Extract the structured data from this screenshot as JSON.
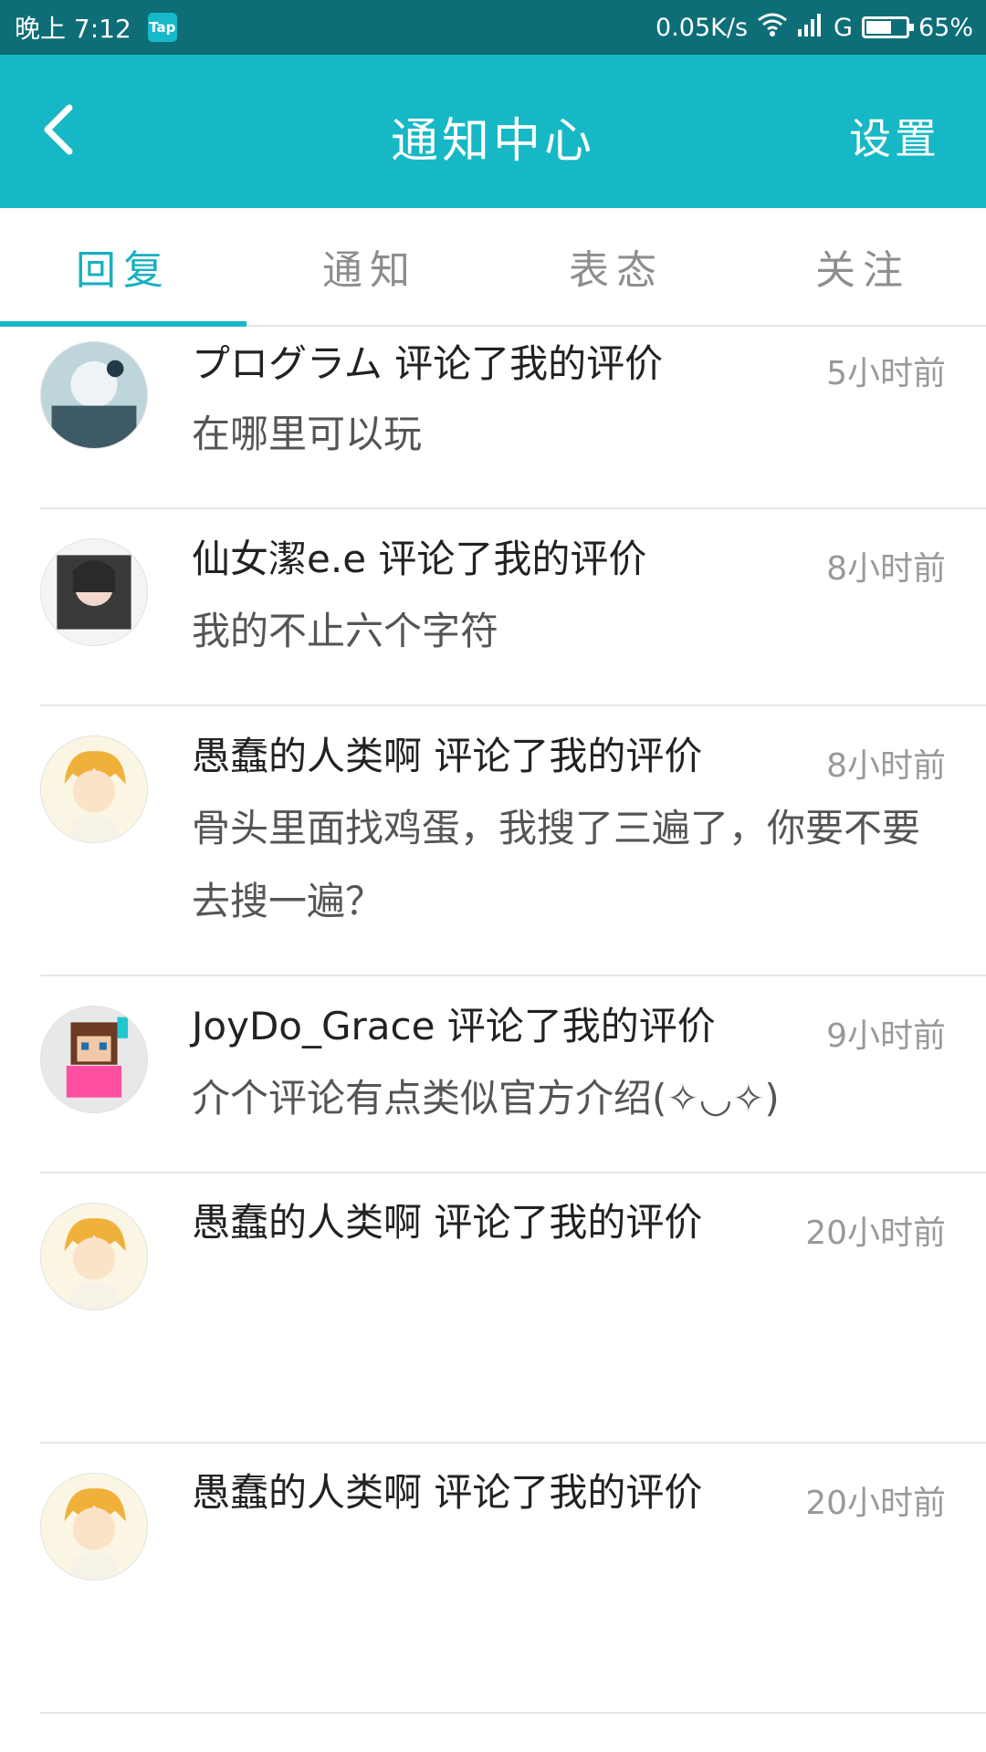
{
  "status_bar": {
    "time": "晚上 7:12",
    "tap_badge": "Tap",
    "net_speed": "0.05K/s",
    "network": "G",
    "battery": "65%",
    "battery_level": 0.65
  },
  "header": {
    "title": "通知中心",
    "settings_label": "设置"
  },
  "tabs": [
    {
      "label": "回复"
    },
    {
      "label": "通知"
    },
    {
      "label": "表态"
    },
    {
      "label": "关注"
    }
  ],
  "items": [
    {
      "title": "プログラム 评论了我的评价",
      "time": "5小时前",
      "body": "在哪里可以玩"
    },
    {
      "title": "仙女潔e.e 评论了我的评价",
      "time": "8小时前",
      "body": "我的不止六个字符"
    },
    {
      "title": "愚蠢的人类啊 评论了我的评价",
      "time": "8小时前",
      "body": "骨头里面找鸡蛋，我搜了三遍了，你要不要去搜一遍？"
    },
    {
      "title": "JoyDo_Grace 评论了我的评价",
      "time": "9小时前",
      "body": "介个评论有点类似官方介绍(✧◡✧)"
    },
    {
      "title": "愚蠢的人类啊 评论了我的评价",
      "time": "20小时前",
      "body": ""
    },
    {
      "title": "愚蠢的人类啊 评论了我的评价",
      "time": "20小时前",
      "body": ""
    }
  ]
}
